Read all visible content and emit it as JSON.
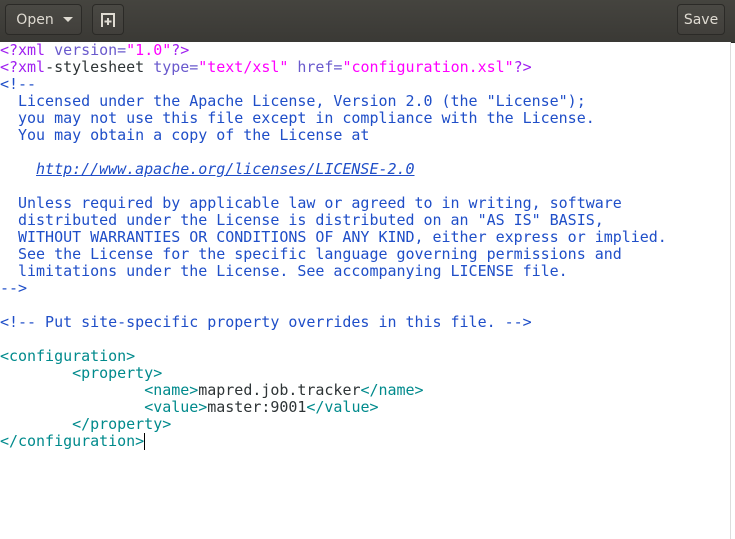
{
  "header": {
    "open_label": "Open",
    "new_tab_icon": "new-document-icon",
    "save_label": "Save"
  },
  "colors": {
    "header_bg": "#3c3b37",
    "processing_instruction": "#a020f0",
    "string": "#ff00ff",
    "attribute": "#6a5acd",
    "comment": "#1f4ec8",
    "tag": "#008a8c"
  },
  "editor": {
    "lines": [
      [
        [
          "<?xml ",
          "pi"
        ],
        [
          "version=",
          "attr"
        ],
        [
          "\"1.0\"",
          "str"
        ],
        [
          "?>",
          "pi"
        ]
      ],
      [
        [
          "<?xml",
          "pi"
        ],
        [
          "-stylesheet ",
          "txt"
        ],
        [
          "type=",
          "attr"
        ],
        [
          "\"text/xsl\"",
          "str"
        ],
        [
          " ",
          "txt"
        ],
        [
          "href=",
          "attr"
        ],
        [
          "\"configuration.xsl\"",
          "str"
        ],
        [
          "?>",
          "pi"
        ]
      ],
      [
        [
          "<!--",
          "cm"
        ]
      ],
      [
        [
          "  Licensed under the Apache License, Version 2.0 (the \"License\");",
          "cm"
        ]
      ],
      [
        [
          "  you may not use this file except in compliance with the License.",
          "cm"
        ]
      ],
      [
        [
          "  You may obtain a copy of the License at",
          "cm"
        ]
      ],
      [
        [
          "",
          "cm"
        ]
      ],
      [
        [
          "    ",
          "cm"
        ],
        [
          "http://www.apache.org/licenses/LICENSE-2.0",
          "link"
        ]
      ],
      [
        [
          "",
          "cm"
        ]
      ],
      [
        [
          "  Unless required by applicable law or agreed to in writing, software",
          "cm"
        ]
      ],
      [
        [
          "  distributed under the License is distributed on an \"AS IS\" BASIS,",
          "cm"
        ]
      ],
      [
        [
          "  WITHOUT WARRANTIES OR CONDITIONS OF ANY KIND, either express or implied.",
          "cm"
        ]
      ],
      [
        [
          "  See the License for the specific language governing permissions and",
          "cm"
        ]
      ],
      [
        [
          "  limitations under the License. See accompanying LICENSE file.",
          "cm"
        ]
      ],
      [
        [
          "-->",
          "cm"
        ]
      ],
      [
        [
          "",
          "txt"
        ]
      ],
      [
        [
          "<!-- Put site-specific property overrides in this file. -->",
          "cm"
        ]
      ],
      [
        [
          "",
          "txt"
        ]
      ],
      [
        [
          "<configuration>",
          "tag"
        ]
      ],
      [
        [
          "        ",
          "txt"
        ],
        [
          "<property>",
          "tag"
        ]
      ],
      [
        [
          "                ",
          "txt"
        ],
        [
          "<name>",
          "tag"
        ],
        [
          "mapred.job.tracker",
          "txt"
        ],
        [
          "</name>",
          "tag"
        ]
      ],
      [
        [
          "                ",
          "txt"
        ],
        [
          "<value>",
          "tag"
        ],
        [
          "master:9001",
          "txt"
        ],
        [
          "</value>",
          "tag"
        ]
      ],
      [
        [
          "        ",
          "txt"
        ],
        [
          "</property>",
          "tag"
        ]
      ],
      [
        [
          "</configuration>",
          "tag"
        ]
      ]
    ]
  }
}
